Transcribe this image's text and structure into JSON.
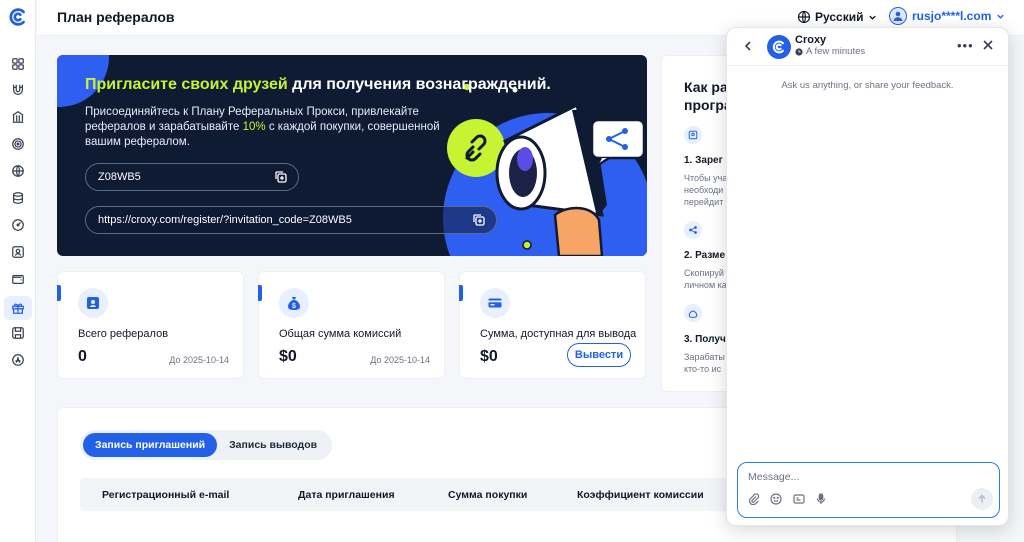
{
  "header": {
    "title": "План рефералов",
    "language": "Русский",
    "user_email": "rusjo****l.com"
  },
  "sidebar": {
    "items": [
      "dashboard",
      "magnet",
      "bank",
      "target",
      "globe",
      "database",
      "speedometer",
      "user-card",
      "wallet",
      "gift",
      "save",
      "app-store"
    ],
    "active": "gift"
  },
  "banner": {
    "title_highlight": "Пригласите своих друзей",
    "title_rest": " для получения вознаграждений.",
    "desc_part1": "Присоединяйтесь к Плану Реферальных Прокси, привлекайте рефералов и зарабатывайте ",
    "desc_percent": "10%",
    "desc_part2": " с каждой покупки, совершенной вашим рефералом.",
    "invite_code": "Z08WB5",
    "invite_link": "https://croxy.com/register/?invitation_code=Z08WB5"
  },
  "cards": [
    {
      "label": "Всего рефералов",
      "value": "0",
      "date": "До 2025-10-14"
    },
    {
      "label": "Общая сумма комиссий",
      "value": "$0",
      "date": "До 2025-10-14"
    },
    {
      "label": "Сумма, доступная для вывода",
      "value": "$0",
      "button": "Вывести"
    }
  ],
  "how": {
    "title": "Как ра... програ...",
    "title_line1": "Как ра",
    "title_line2": "програ",
    "steps": [
      {
        "heading": "1. Зарег",
        "text_lines": [
          "Чтобы уча",
          "необходи",
          "перейдит"
        ]
      },
      {
        "heading": "2. Разме",
        "text_lines": [
          "Скопируй",
          "личном ка"
        ]
      },
      {
        "heading": "3. Получ",
        "text_lines": [
          "Зарабаты",
          "кто-то ис"
        ]
      }
    ]
  },
  "records": {
    "tabs": [
      "Запись приглашений",
      "Запись выводов"
    ],
    "active_tab": 0,
    "columns": [
      "Регистрационный e-mail",
      "Дата приглашения",
      "Сумма покупки",
      "Коэффициент комиссии"
    ]
  },
  "chat": {
    "name": "Croxy",
    "status": "A few minutes",
    "hint": "Ask us anything, or share your feedback.",
    "placeholder": "Message..."
  },
  "colors": {
    "accent": "#2260e8",
    "banner_bg": "#0f1a33",
    "highlight": "#c6f432"
  }
}
